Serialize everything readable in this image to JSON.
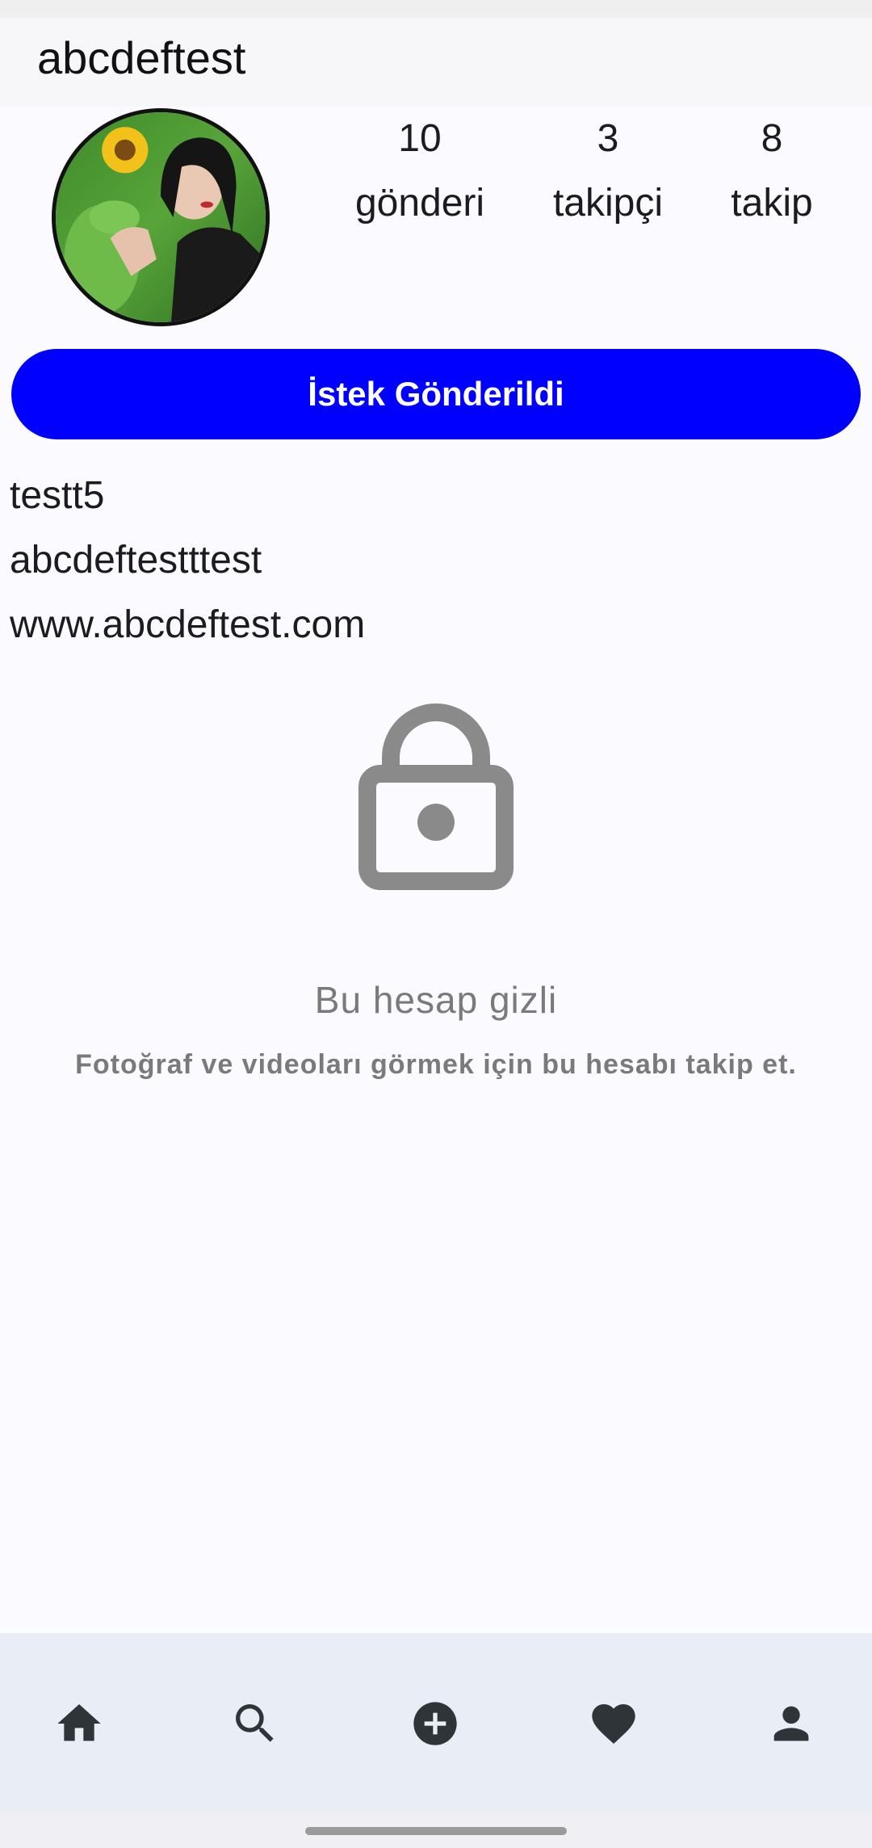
{
  "header": {
    "username": "abcdeftest"
  },
  "profile": {
    "avatar_icon": "profile-photo",
    "stats": [
      {
        "count": "10",
        "label": "gönderi"
      },
      {
        "count": "3",
        "label": "takipçi"
      },
      {
        "count": "8",
        "label": "takip"
      }
    ],
    "follow_button_label": "İstek Gönderildi",
    "name": "testt5",
    "bio": "abcdeftestttest",
    "website": "www.abcdeftest.com"
  },
  "private_notice": {
    "icon": "lock-icon",
    "title": "Bu hesap gizli",
    "subtitle": "Fotoğraf ve videoları görmek için bu hesabı takip et."
  },
  "bottom_nav": {
    "items": [
      {
        "icon": "home-icon"
      },
      {
        "icon": "search-icon"
      },
      {
        "icon": "add-circle-icon"
      },
      {
        "icon": "heart-icon"
      },
      {
        "icon": "person-icon"
      }
    ]
  },
  "colors": {
    "accent": "#0000ff",
    "background": "#fbfafe",
    "nav_background": "#e8edf6",
    "muted_text": "#7a7a7a",
    "icon": "#2f3438"
  }
}
